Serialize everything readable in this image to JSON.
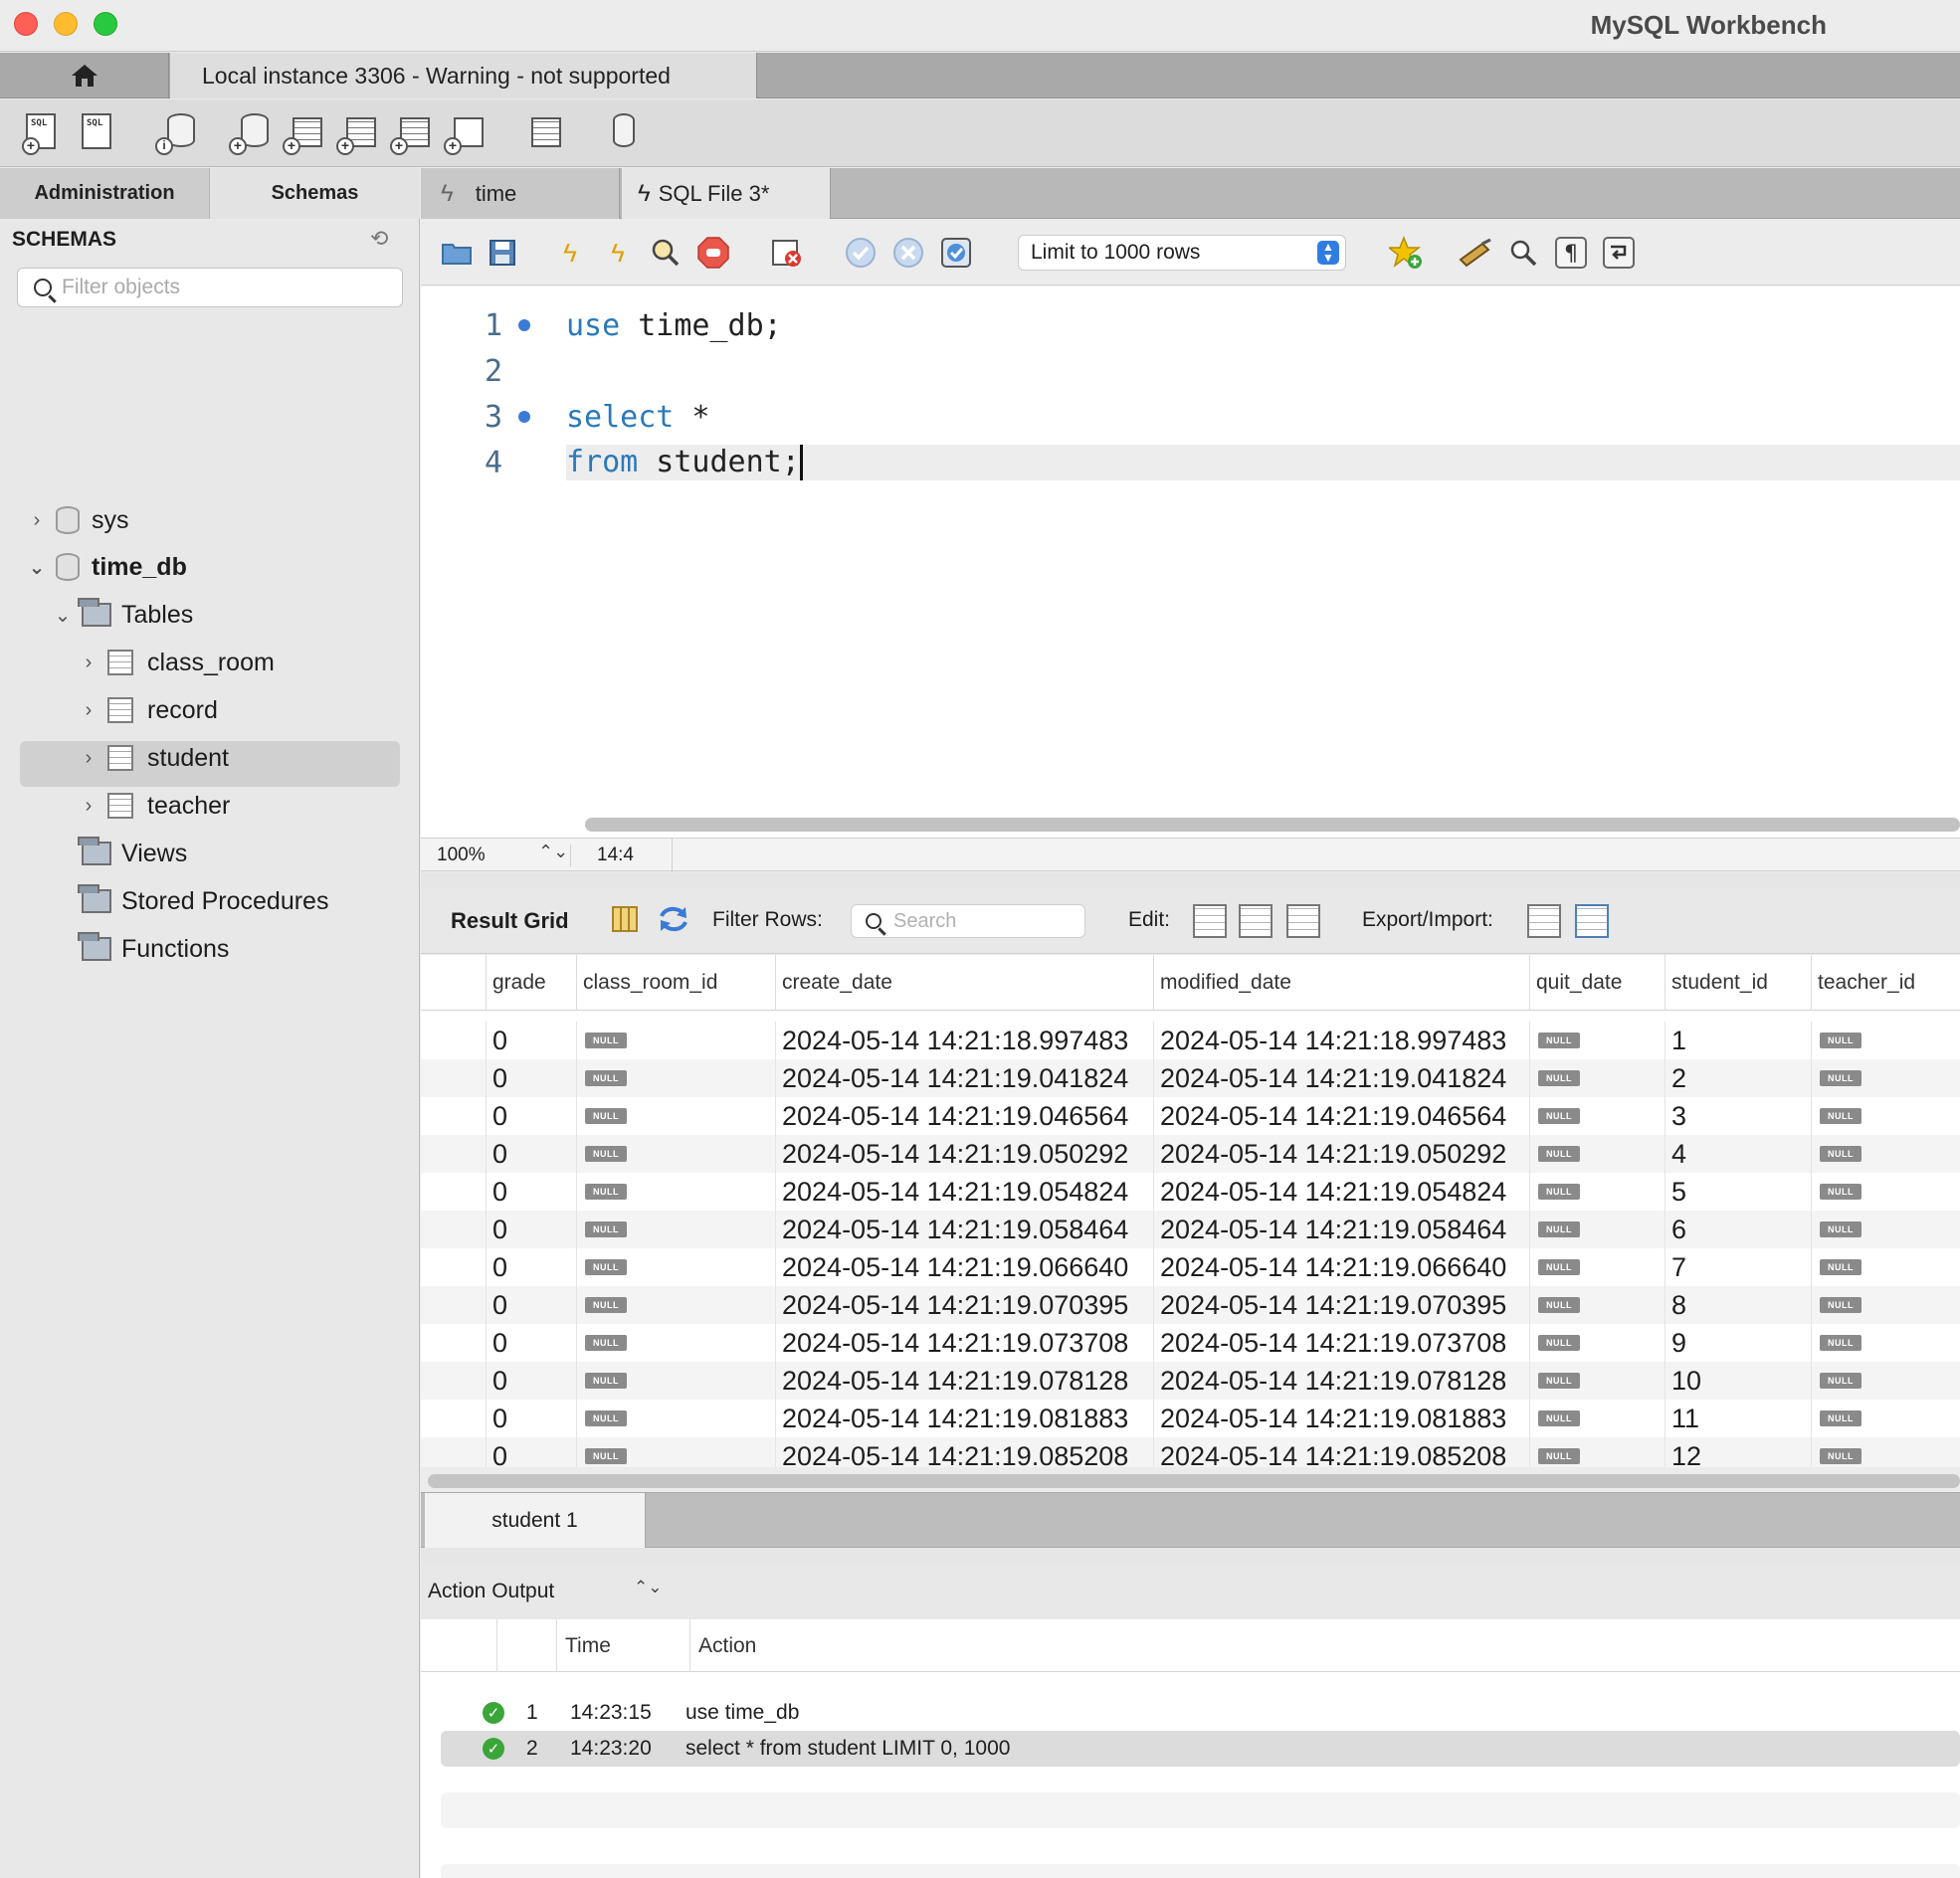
{
  "window": {
    "title": "MySQL Workbench"
  },
  "connection_tabs": {
    "home_icon": "home-icon",
    "active": "Local instance 3306 - Warning - not supported"
  },
  "sidebar": {
    "tabs": [
      "Administration",
      "Schemas"
    ],
    "header": "SCHEMAS",
    "filter_placeholder": "Filter objects",
    "tree": {
      "sys": "sys",
      "time_db": "time_db",
      "tables": "Tables",
      "table_items": [
        "class_room",
        "record",
        "student",
        "teacher"
      ],
      "views": "Views",
      "stored_procedures": "Stored Procedures",
      "functions": "Functions"
    },
    "selected": "student"
  },
  "query_tabs": [
    "time",
    "SQL File 3*"
  ],
  "editor_toolbar": {
    "limit_label": "Limit to 1000 rows"
  },
  "editor": {
    "lines": [
      {
        "num": "1",
        "kw": "use",
        "rest": " time_db;"
      },
      {
        "num": "2",
        "kw": "",
        "rest": ""
      },
      {
        "num": "3",
        "kw": "select",
        "rest": " *"
      },
      {
        "num": "4",
        "kw": "from",
        "rest": " student;"
      }
    ],
    "zoom": "100%",
    "cursor_pos": "14:4"
  },
  "result_toolbar": {
    "title": "Result Grid",
    "filter_label": "Filter Rows:",
    "search_placeholder": "Search",
    "edit_label": "Edit:",
    "export_label": "Export/Import:"
  },
  "result_grid": {
    "columns": [
      "grade",
      "class_room_id",
      "create_date",
      "modified_date",
      "quit_date",
      "student_id",
      "teacher_id"
    ],
    "null_text": "NULL",
    "rows": [
      [
        "0",
        "NULL",
        "2024-05-14 14:21:18.997483",
        "2024-05-14 14:21:18.997483",
        "NULL",
        "1",
        "NULL"
      ],
      [
        "0",
        "NULL",
        "2024-05-14 14:21:19.041824",
        "2024-05-14 14:21:19.041824",
        "NULL",
        "2",
        "NULL"
      ],
      [
        "0",
        "NULL",
        "2024-05-14 14:21:19.046564",
        "2024-05-14 14:21:19.046564",
        "NULL",
        "3",
        "NULL"
      ],
      [
        "0",
        "NULL",
        "2024-05-14 14:21:19.050292",
        "2024-05-14 14:21:19.050292",
        "NULL",
        "4",
        "NULL"
      ],
      [
        "0",
        "NULL",
        "2024-05-14 14:21:19.054824",
        "2024-05-14 14:21:19.054824",
        "NULL",
        "5",
        "NULL"
      ],
      [
        "0",
        "NULL",
        "2024-05-14 14:21:19.058464",
        "2024-05-14 14:21:19.058464",
        "NULL",
        "6",
        "NULL"
      ],
      [
        "0",
        "NULL",
        "2024-05-14 14:21:19.066640",
        "2024-05-14 14:21:19.066640",
        "NULL",
        "7",
        "NULL"
      ],
      [
        "0",
        "NULL",
        "2024-05-14 14:21:19.070395",
        "2024-05-14 14:21:19.070395",
        "NULL",
        "8",
        "NULL"
      ],
      [
        "0",
        "NULL",
        "2024-05-14 14:21:19.073708",
        "2024-05-14 14:21:19.073708",
        "NULL",
        "9",
        "NULL"
      ],
      [
        "0",
        "NULL",
        "2024-05-14 14:21:19.078128",
        "2024-05-14 14:21:19.078128",
        "NULL",
        "10",
        "NULL"
      ],
      [
        "0",
        "NULL",
        "2024-05-14 14:21:19.081883",
        "2024-05-14 14:21:19.081883",
        "NULL",
        "11",
        "NULL"
      ],
      [
        "0",
        "NULL",
        "2024-05-14 14:21:19.085208",
        "2024-05-14 14:21:19.085208",
        "NULL",
        "12",
        "NULL"
      ]
    ]
  },
  "result_tabs": [
    "student 1"
  ],
  "action_output": {
    "title": "Action Output",
    "columns": [
      "Time",
      "Action"
    ],
    "rows": [
      {
        "num": "1",
        "time": "14:23:15",
        "action": "use time_db"
      },
      {
        "num": "2",
        "time": "14:23:20",
        "action": "select * from student LIMIT 0, 1000"
      }
    ]
  }
}
